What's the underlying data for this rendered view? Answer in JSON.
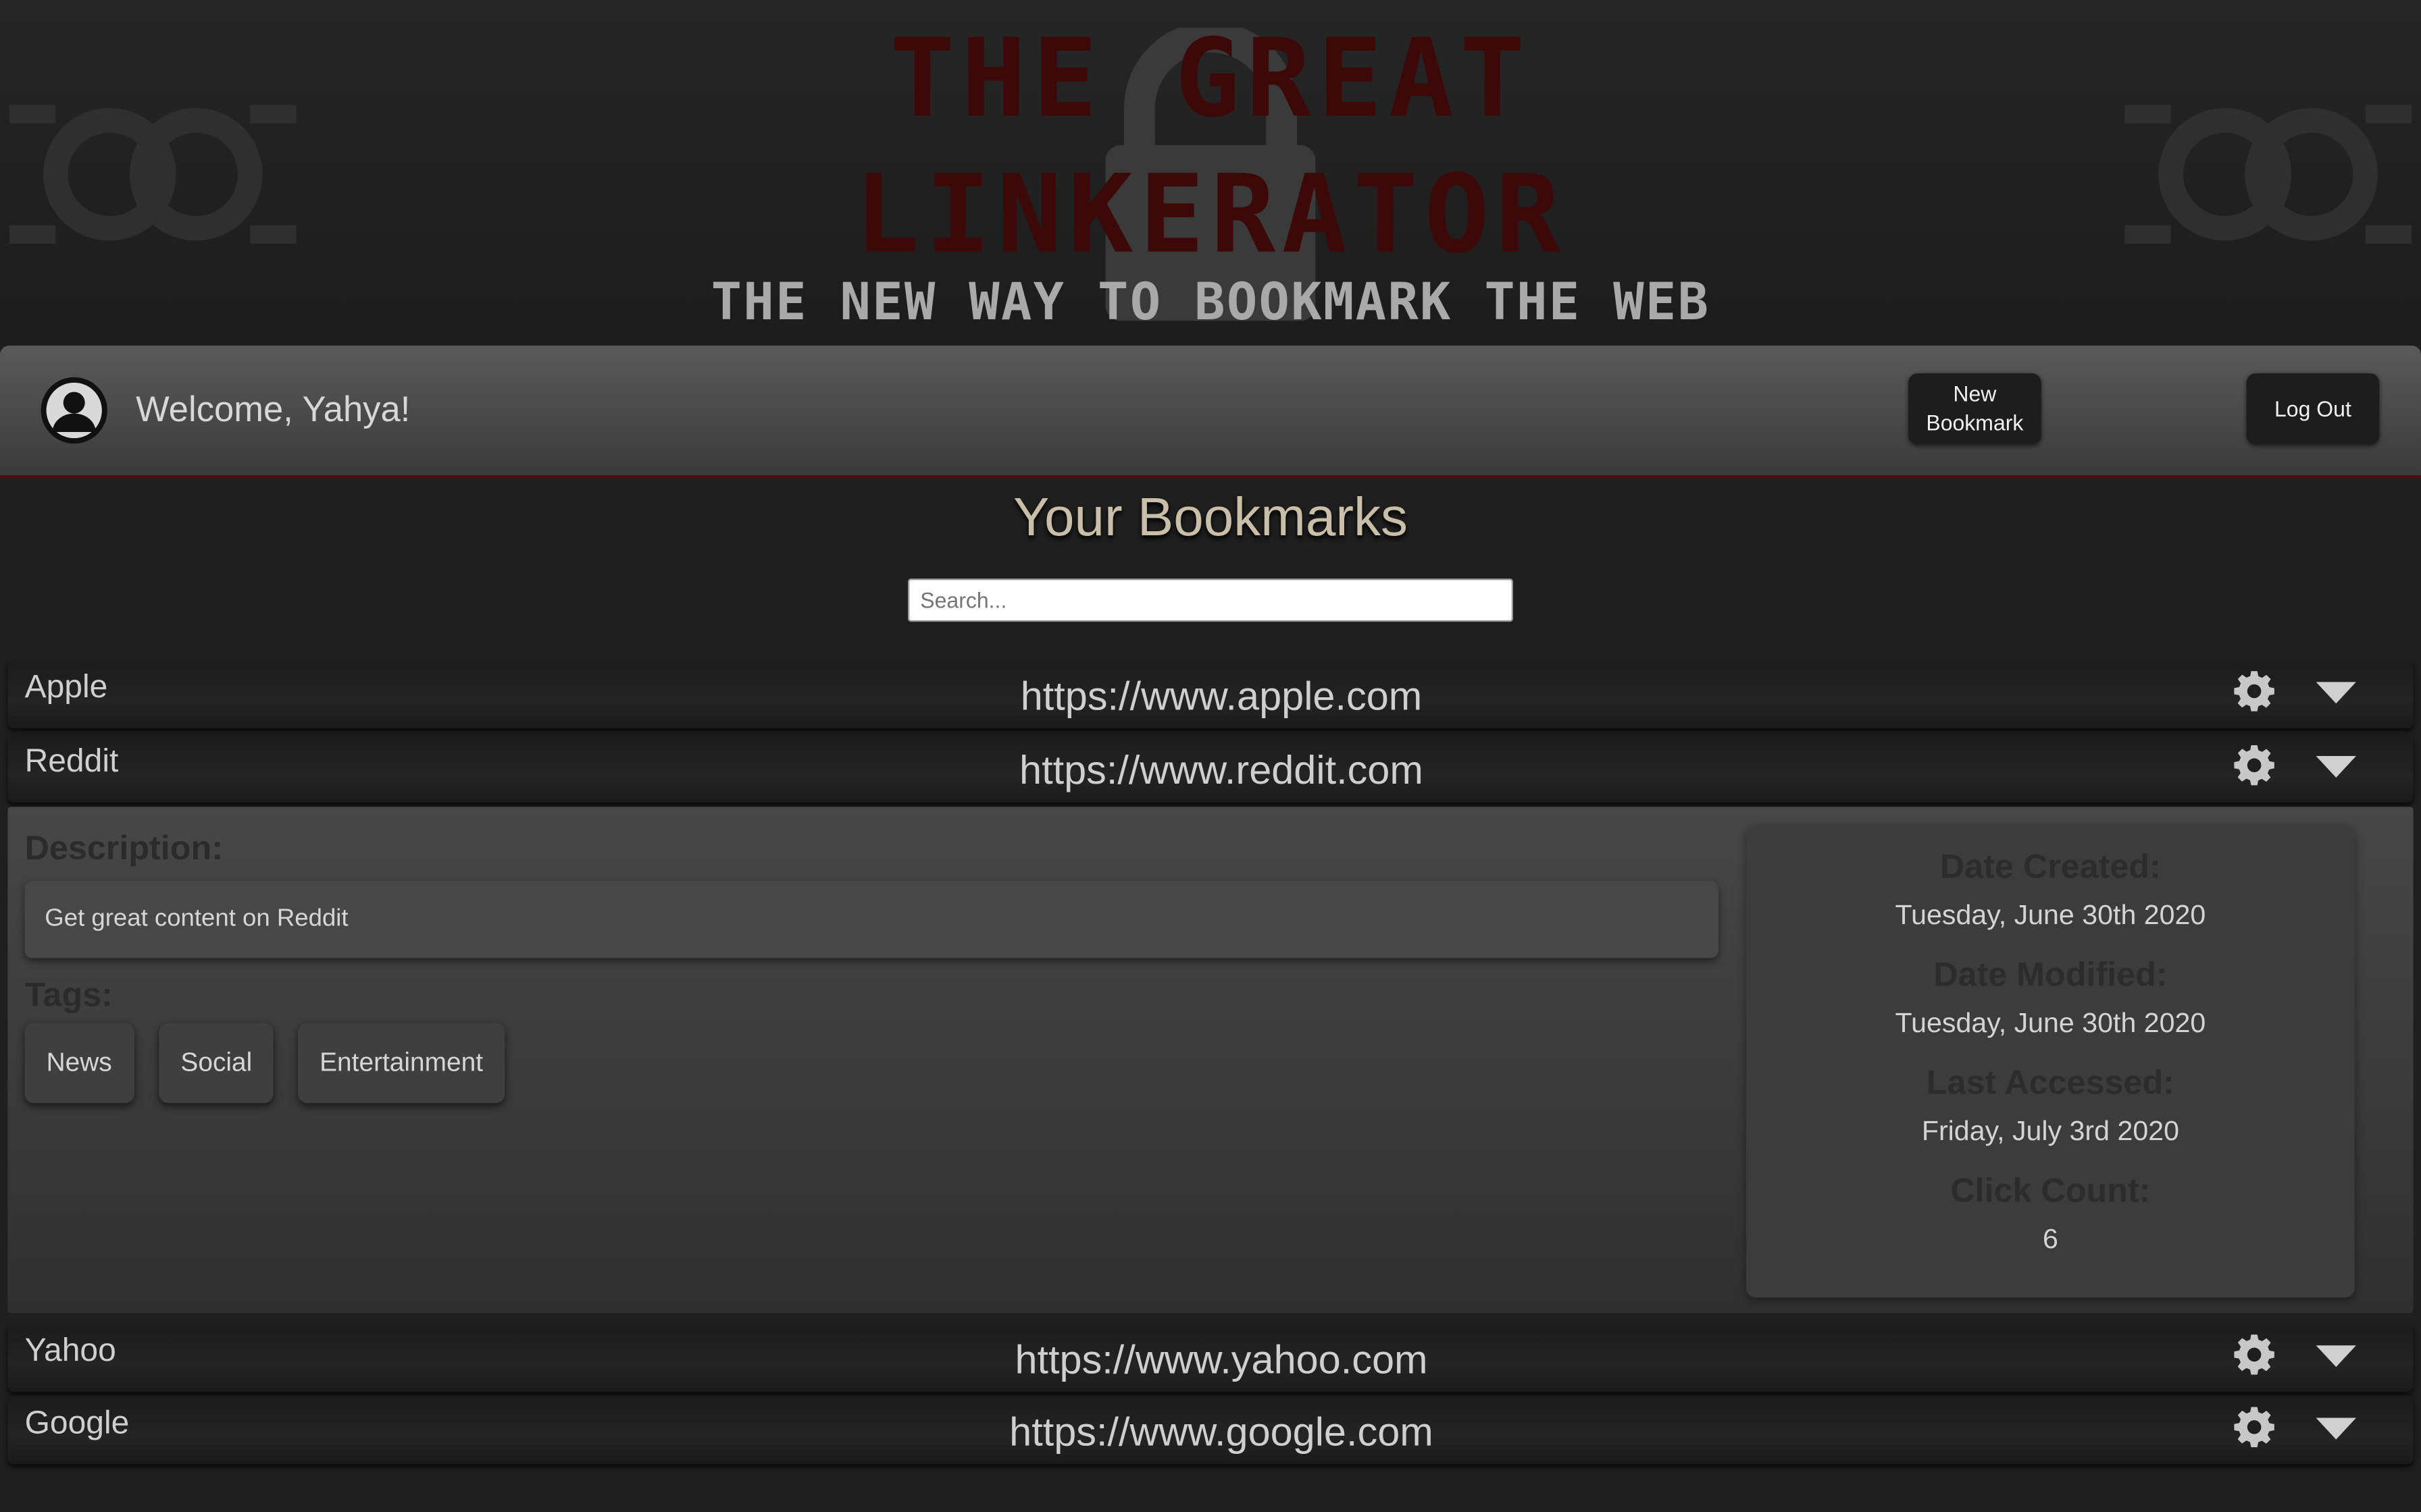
{
  "banner": {
    "title_line1": "THE GREAT",
    "title_line2": "LINKERATOR",
    "tagline": "THE NEW WAY TO BOOKMARK THE WEB"
  },
  "navbar": {
    "welcome": "Welcome, Yahya!",
    "new_bookmark_label_line1": "New",
    "new_bookmark_label_line2": "Bookmark",
    "logout_label": "Log Out"
  },
  "main": {
    "heading": "Your Bookmarks",
    "search_placeholder": "Search..."
  },
  "bookmarks": [
    {
      "name": "Apple",
      "url": "https://www.apple.com"
    },
    {
      "name": "Reddit",
      "url": "https://www.reddit.com"
    },
    {
      "name": "Yahoo",
      "url": "https://www.yahoo.com"
    },
    {
      "name": "Google",
      "url": "https://www.google.com"
    }
  ],
  "expanded": {
    "description_label": "Description:",
    "description": "Get great content on Reddit",
    "tags_label": "Tags:",
    "tags": [
      "News",
      "Social",
      "Entertainment"
    ],
    "date_created_label": "Date Created:",
    "date_created": "Tuesday, June 30th 2020",
    "date_modified_label": "Date Modified:",
    "date_modified": "Tuesday, June 30th 2020",
    "last_accessed_label": "Last Accessed:",
    "last_accessed": "Friday, July 3rd 2020",
    "click_count_label": "Click Count:",
    "click_count": "6"
  },
  "icons": {
    "row_settings": "gear-icon",
    "row_expand": "caret-down-icon",
    "user": "user-avatar-icon",
    "banner_lock": "lock-icon",
    "banner_chain": "chain-link-icon"
  },
  "colors": {
    "background": "#1f1f1f",
    "title_red": "#3d0808",
    "heading": "#c9bfa8"
  }
}
